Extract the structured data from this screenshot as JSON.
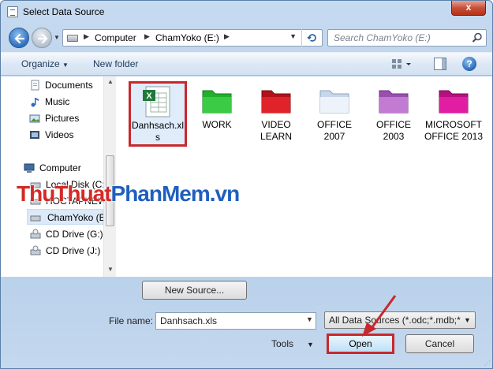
{
  "window": {
    "title": "Select Data Source",
    "close_label": "x"
  },
  "address": {
    "crumbs": [
      "Computer",
      "ChamYoko (E:)"
    ],
    "search_placeholder": "Search ChamYoko (E:)"
  },
  "toolbar": {
    "organize_label": "Organize",
    "new_folder_label": "New folder",
    "help_label": "?"
  },
  "nav": {
    "items": [
      {
        "label": "Documents",
        "icon": "documents-icon"
      },
      {
        "label": "Music",
        "icon": "music-icon"
      },
      {
        "label": "Pictures",
        "icon": "pictures-icon"
      },
      {
        "label": "Videos",
        "icon": "videos-icon"
      },
      {
        "label": "Computer",
        "icon": "computer-icon"
      },
      {
        "label": "Local Disk (C:)",
        "icon": "drive-icon"
      },
      {
        "label": "HOCTAPNEW (D:)",
        "icon": "drive-icon"
      },
      {
        "label": "ChamYoko (E:)",
        "icon": "drive-icon",
        "selected": true
      },
      {
        "label": "CD Drive (G:)",
        "icon": "cd-drive-icon"
      },
      {
        "label": "CD Drive (J:)",
        "icon": "cd-drive-icon"
      }
    ]
  },
  "files": [
    {
      "label": "Danhsach.xls",
      "icon": "excel-file-icon",
      "selected": true
    },
    {
      "label": "WORK",
      "icon": "folder-icon",
      "color": "#22b02c"
    },
    {
      "label": "VIDEO LEARN",
      "icon": "folder-icon",
      "color": "#d81a22"
    },
    {
      "label": "OFFICE 2007",
      "icon": "folder-icon",
      "color": "#e6eef9"
    },
    {
      "label": "OFFICE 2003",
      "icon": "folder-icon",
      "color": "#b86bc9"
    },
    {
      "label": "MICROSOFT OFFICE 2013",
      "icon": "folder-icon",
      "color": "#d9179a"
    }
  ],
  "watermark": {
    "part1": "ThuThuat",
    "part2": "PhanMem",
    "part3": ".vn"
  },
  "bottom": {
    "new_source_label": "New Source...",
    "file_name_label": "File name:",
    "file_name_value": "Danhsach.xls",
    "filter_value": "All Data Sources (*.odc;*.mdb;*",
    "tools_label": "Tools",
    "open_label": "Open",
    "cancel_label": "Cancel"
  },
  "colors": {
    "highlight": "#c8282d",
    "accent": "#1f5fbe"
  }
}
